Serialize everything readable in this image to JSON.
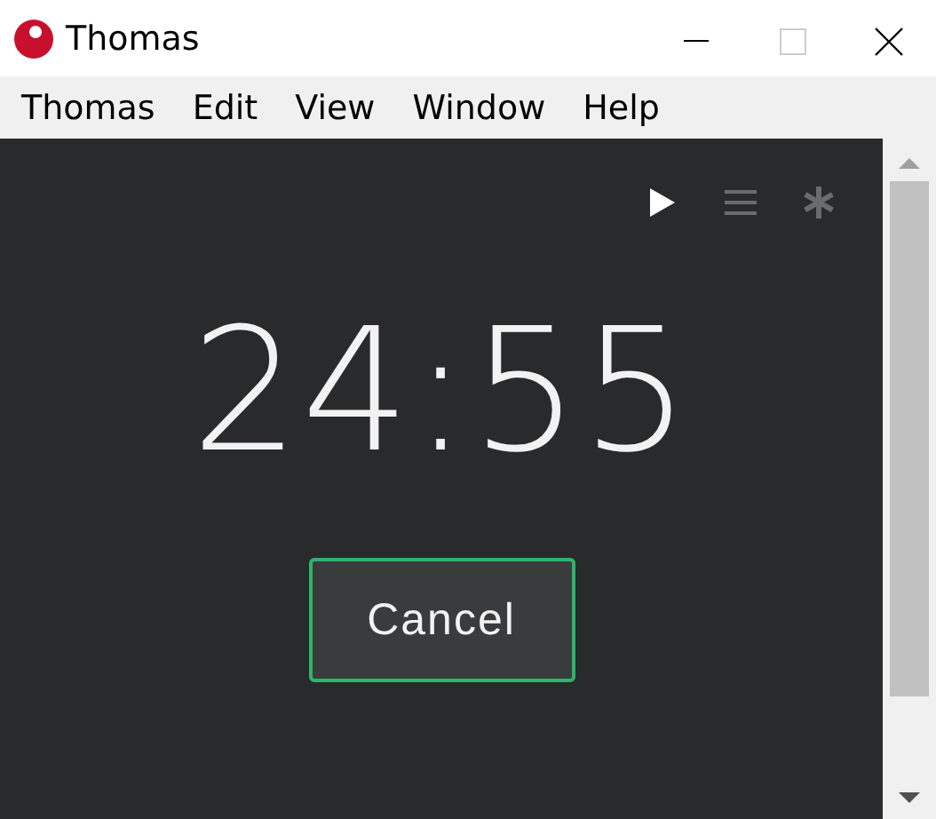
{
  "window": {
    "title": "Thomas"
  },
  "menu": [
    {
      "label": "Thomas"
    },
    {
      "label": "Edit"
    },
    {
      "label": "View"
    },
    {
      "label": "Window"
    },
    {
      "label": "Help"
    }
  ],
  "toolbar": [
    {
      "kind": "play",
      "disabled": false
    },
    {
      "kind": "list",
      "disabled": true
    },
    {
      "kind": "settings",
      "disabled": true
    }
  ],
  "timer": "24:55",
  "buttons": [
    "Cancel"
  ]
}
